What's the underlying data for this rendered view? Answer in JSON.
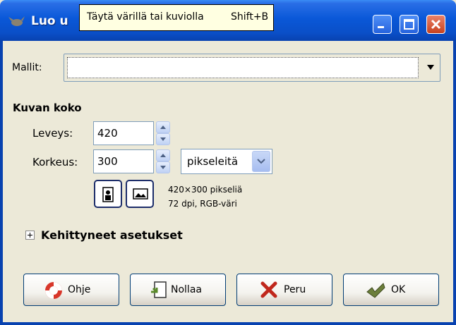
{
  "window": {
    "title_visible": "Luo u",
    "tooltip": {
      "text": "Täytä värillä tai kuviolla",
      "shortcut": "Shift+B"
    }
  },
  "templates": {
    "label": "Mallit:",
    "value": ""
  },
  "image_size": {
    "title": "Kuvan koko",
    "width_label": "Leveys:",
    "width_value": "420",
    "height_label": "Korkeus:",
    "height_value": "300",
    "unit": "pikseleitä",
    "info_line1": "420×300 pikseliä",
    "info_line2": "72 dpi, RGB-väri"
  },
  "advanced": {
    "label": "Kehittyneet asetukset"
  },
  "buttons": {
    "help": "Ohje",
    "reset": "Nollaa",
    "cancel": "Peru",
    "ok": "OK"
  },
  "icons": {
    "app": "gimp-wilber-icon",
    "portrait": "portrait-icon",
    "landscape": "landscape-icon",
    "help": "lifebuoy-icon",
    "reset": "reset-icon",
    "cancel": "red-x-icon",
    "ok": "checkmark-icon"
  },
  "colors": {
    "titlebar": "#0a58d8",
    "tooltip_bg": "#ffffe1",
    "dialog_bg": "#ece9d8"
  }
}
